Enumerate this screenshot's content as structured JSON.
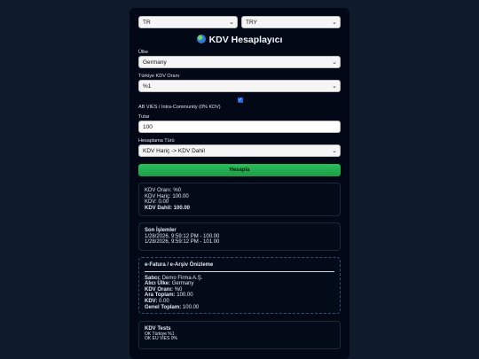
{
  "top": {
    "country_select": "TR",
    "currency_select": "TRY"
  },
  "title": "KDV Hesaplayıcı",
  "form": {
    "country_label": "Ülke",
    "country_value": "Germany",
    "rate_label": "Türkiye KDV Oranı",
    "rate_value": "%1",
    "vies_label": "AB VIES / Intra-Community (0% KDV)",
    "vies_checked": true,
    "amount_label": "Tutar",
    "amount_value": "100",
    "calc_type_label": "Hesaplama Türü",
    "calc_type_value": "KDV Hariç -> KDV Dahil",
    "calc_button": "Hesapla"
  },
  "result": {
    "rate": "KDV Oranı: %0",
    "excl": "KDV Hariç: 100.00",
    "vat": "KDV: 0.00",
    "incl": "KDV Dahil: 100.00"
  },
  "recent": {
    "title": "Son İşlemler",
    "items": [
      "1/28/2026, 9:59:12 PM - 100.00",
      "1/28/2026, 9:59:12 PM - 101.00"
    ]
  },
  "invoice": {
    "title": "e-Fatura / e-Arşiv Önizleme",
    "seller_k": "Satıcı:",
    "seller_v": "Demo Firma A.Ş.",
    "buyer_k": "Alıcı Ülke:",
    "buyer_v": "Germany",
    "rate_k": "KDV Oranı:",
    "rate_v": "%0",
    "subtotal_k": "Ara Toplam:",
    "subtotal_v": "100.00",
    "vat_k": "KDV:",
    "vat_v": "0.00",
    "total_k": "Genel Toplam:",
    "total_v": "100.00"
  },
  "tests": {
    "title": "KDV Tests",
    "items": [
      "OK Türkiye %1",
      "OK EU VIES 0%"
    ]
  }
}
